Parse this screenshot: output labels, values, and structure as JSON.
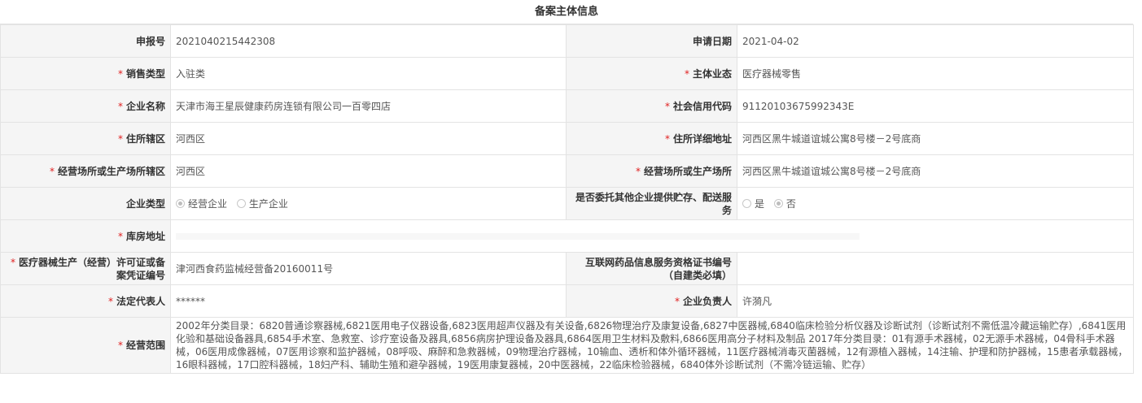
{
  "title": "备案主体信息",
  "rows": {
    "r1": {
      "l1": "申报号",
      "v1": "2021040215442308",
      "l2": "申请日期",
      "v2": "2021-04-02"
    },
    "r2": {
      "l1": "销售类型",
      "v1": "入驻类",
      "l2": "主体业态",
      "v2": "医疗器械零售"
    },
    "r3": {
      "l1": "企业名称",
      "v1": "天津市海王星辰健康药房连锁有限公司一百零四店",
      "l2": "社会信用代码",
      "v2": "91120103675992343E"
    },
    "r4": {
      "l1": "住所辖区",
      "v1": "河西区",
      "l2": "住所详细地址",
      "v2": "河西区黑牛城道谊城公寓8号楼－2号底商"
    },
    "r5": {
      "l1": "经营场所或生产场所辖区",
      "v1": "河西区",
      "l2": "经营场所或生产场所",
      "v2": "河西区黑牛城道谊城公寓8号楼－2号底商"
    },
    "r6": {
      "l1": "企业类型",
      "opt1": "经营企业",
      "opt2": "生产企业",
      "l2": "是否委托其他企业提供贮存、配送服务",
      "opt3": "是",
      "opt4": "否"
    },
    "r7": {
      "l1": "库房地址"
    },
    "r8": {
      "l1": "医疗器械生产（经营）许可证或备案凭证编号",
      "v1": "津河西食药监械经营备20160011号",
      "l2": "互联网药品信息服务资格证书编号（自建类必填）",
      "v2": ""
    },
    "r9": {
      "l1": "法定代表人",
      "v1": "******",
      "l2": "企业负责人",
      "v2": "许漪凡"
    },
    "r10": {
      "l1": "经营范围",
      "v1": "2002年分类目录：6820普通诊察器械,6821医用电子仪器设备,6823医用超声仪器及有关设备,6826物理治疗及康复设备,6827中医器械,6840临床检验分析仪器及诊断试剂（诊断试剂不需低温冷藏运输贮存）,6841医用化验和基础设备器具,6854手术室、急救室、诊疗室设备及器具,6856病房护理设备及器具,6864医用卫生材料及敷料,6866医用高分子材料及制品 2017年分类目录：01有源手术器械，02无源手术器械，04骨科手术器械，06医用成像器械，07医用诊察和监护器械，08呼吸、麻醉和急救器械，09物理治疗器械，10输血、透析和体外循环器械，11医疗器械消毒灭菌器械，12有源植入器械，14注输、护理和防护器械，15患者承载器械，16眼科器械，17口腔科器械，18妇产科、辅助生殖和避孕器械，19医用康复器械，20中医器械，22临床检验器械，6840体外诊断试剂（不需冷链运输、贮存）"
    }
  },
  "required_mark": "*"
}
